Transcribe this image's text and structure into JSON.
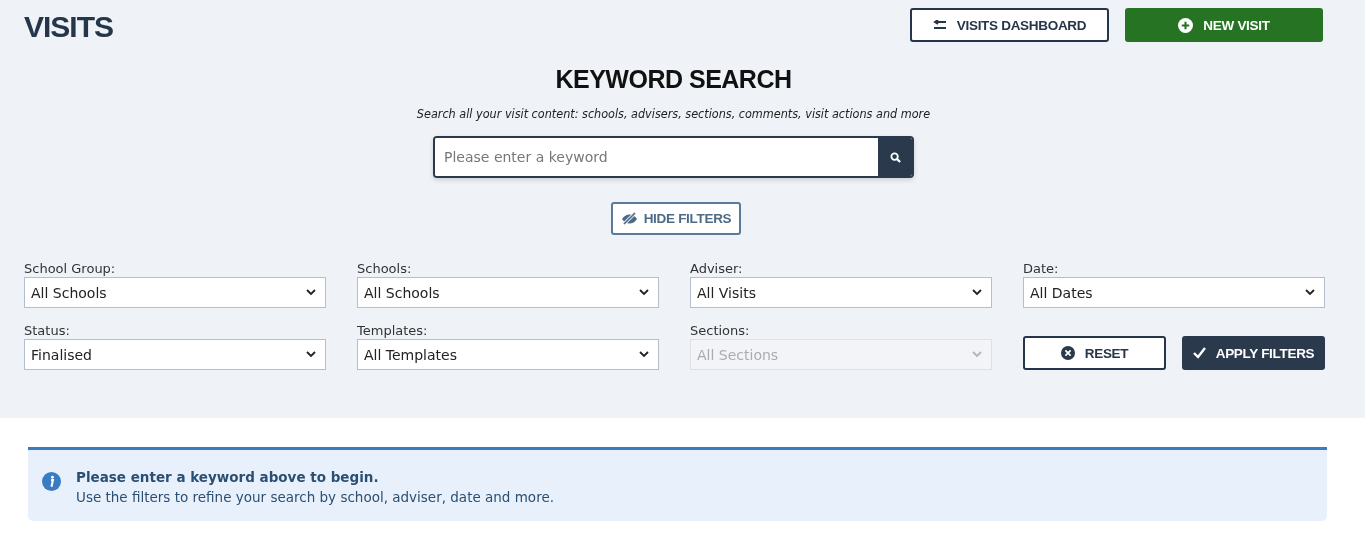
{
  "page_title": "VISITS",
  "header_buttons": [
    {
      "kind": "outline",
      "label": "VISITS DASHBOARD"
    },
    {
      "kind": "primary",
      "label": "NEW VISIT"
    }
  ],
  "search": {
    "title": "KEYWORD SEARCH",
    "subtitle": "Search all your visit content: schools, advisers, sections, comments, visit actions and more",
    "placeholder": "Please enter a keyword"
  },
  "toggle_filters": {
    "label": "HIDE FILTERS"
  },
  "filters": [
    {
      "label": "School Group:",
      "value": "All Schools",
      "disabled": false
    },
    {
      "label": "Schools:",
      "value": "All Schools",
      "disabled": false
    },
    {
      "label": "Adviser:",
      "value": "All Visits",
      "disabled": false
    },
    {
      "label": "Date:",
      "value": "All Dates",
      "disabled": false
    },
    {
      "label": "Status:",
      "value": "Finalised",
      "disabled": false
    },
    {
      "label": "Templates:",
      "value": "All Templates",
      "disabled": false
    },
    {
      "label": "Sections:",
      "value": "All Sections",
      "disabled": true
    }
  ],
  "filter_buttons": [
    {
      "kind": "outline",
      "label": "RESET"
    },
    {
      "kind": "dark",
      "label": "APPLY FILTERS"
    }
  ],
  "alert": {
    "title": "Please enter a keyword above to begin.",
    "text": "Use the filters to refine your search by school, adviser, date and more."
  }
}
